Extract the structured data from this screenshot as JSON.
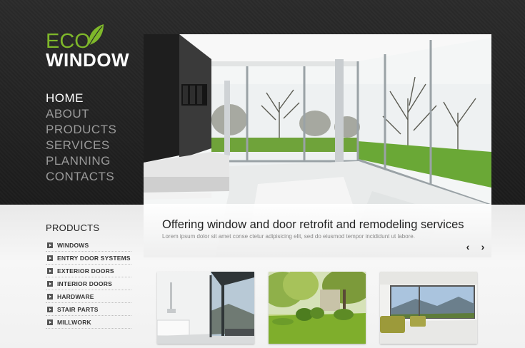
{
  "logo": {
    "eco": "ECO",
    "window": "WINDOW"
  },
  "nav": {
    "items": [
      {
        "label": "HOME",
        "active": true
      },
      {
        "label": "ABOUT"
      },
      {
        "label": "PRODUCTS"
      },
      {
        "label": "SERVICES"
      },
      {
        "label": "PLANNING"
      },
      {
        "label": "CONTACTS"
      }
    ]
  },
  "hero": {
    "title": "Offering window and door retrofit and remodeling services",
    "subtitle": "Lorem ipsum dolor sit amet conse ctetur adipisicing elit, sed do eiusmod tempor incididunt ut labore.",
    "prev_icon": "chevron-left-icon",
    "next_icon": "chevron-right-icon",
    "prev_symbol": "‹",
    "next_symbol": "›"
  },
  "sidebar": {
    "title": "PRODUCTS",
    "items": [
      {
        "label": "WINDOWS"
      },
      {
        "label": "ENTRY DOOR SYSTEMS"
      },
      {
        "label": "EXTERIOR DOORS"
      },
      {
        "label": "INTERIOR DOORS"
      },
      {
        "label": "HARDWARE"
      },
      {
        "label": "STAIR PARTS"
      },
      {
        "label": "MILLWORK"
      }
    ]
  },
  "colors": {
    "accent_green": "#7fb82a",
    "dark_bg": "#222222",
    "nav_inactive": "#9a9a9a"
  }
}
